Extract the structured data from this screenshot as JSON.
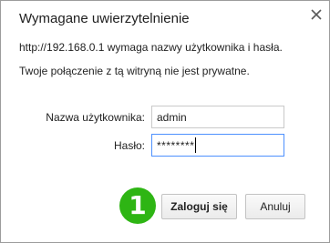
{
  "dialog": {
    "title": "Wymagane uwierzytelnienie",
    "close_icon": "close-icon",
    "message_line1": "http://192.168.0.1 wymaga nazwy użytkownika i hasła.",
    "message_line2": "Twoje połączenie z tą witryną nie jest prywatne.",
    "username_label": "Nazwa użytkownika:",
    "username_value": "admin",
    "password_label": "Hasło:",
    "password_value": "********",
    "login_button": "Zaloguj się",
    "cancel_button": "Anuluj",
    "step_badge": "1"
  },
  "colors": {
    "badge_green": "#2eb514",
    "focus_border": "#4d90fe"
  }
}
